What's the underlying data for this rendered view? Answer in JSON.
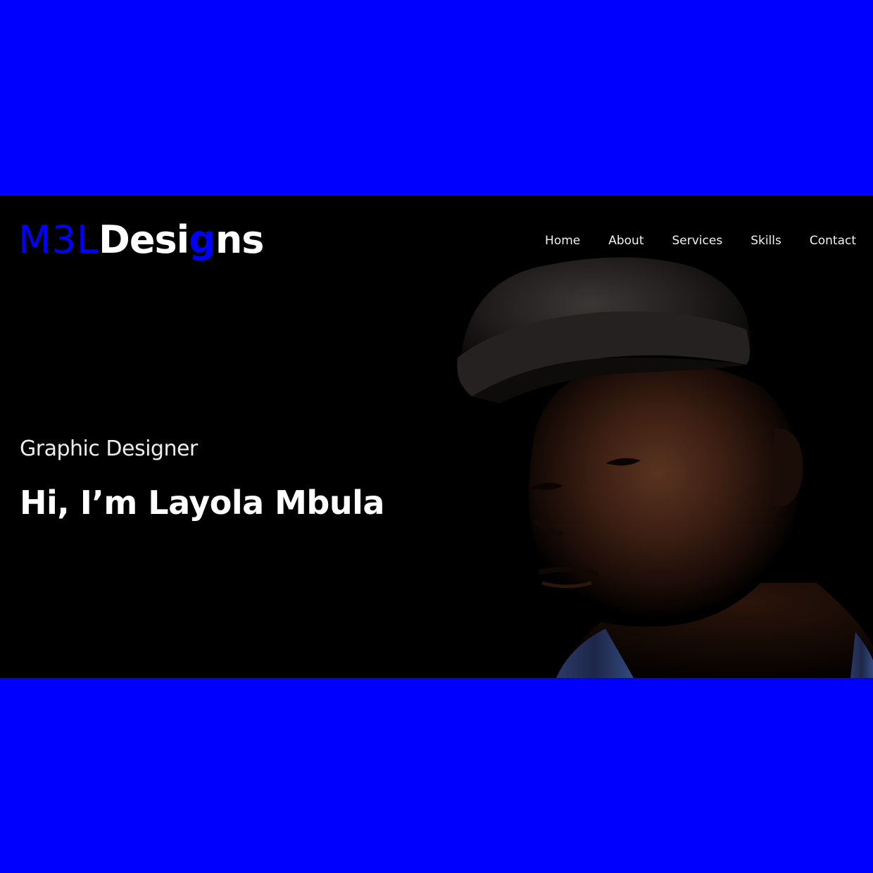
{
  "page": {
    "background_color": "#0000ff",
    "hero_background_color": "#000000",
    "accent_color": "#0000ff"
  },
  "logo": {
    "part_a": "M3L",
    "part_b": "Desi",
    "part_c": "g",
    "part_d": "ns"
  },
  "nav": {
    "items": [
      {
        "label": "Home"
      },
      {
        "label": "About"
      },
      {
        "label": "Services"
      },
      {
        "label": "Skills"
      },
      {
        "label": "Contact"
      }
    ]
  },
  "hero": {
    "subtitle": "Graphic Designer",
    "headline": "Hi, I’m Layola Mbula",
    "photo_subject": "man-in-cap-portrait"
  }
}
